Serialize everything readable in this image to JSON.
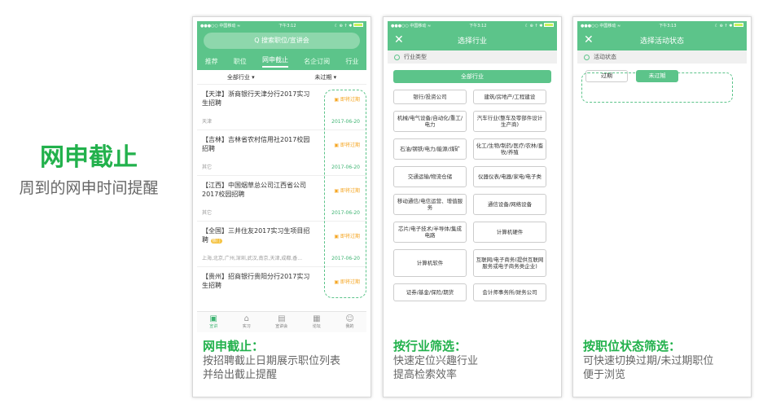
{
  "hero": {
    "title": "网申截止",
    "subtitle": "周到的网申时间提醒"
  },
  "status": {
    "carrier": "●●●○○ 中国移动 ≈",
    "time1": "下午3:12",
    "time3": "下午3:13",
    "icons": "☾ ⊕ ↑ ✱"
  },
  "screen1": {
    "search_placeholder": "Q 搜索职位/宣讲会",
    "tabs": [
      "推荐",
      "职位",
      "网申截止",
      "名企订阅",
      "行业"
    ],
    "filter_industry": "全部行业 ▾",
    "filter_status": "未过期 ▾",
    "jobs": [
      {
        "title": "【天津】浙商银行天津分行2017实习生招聘",
        "loc": "天津",
        "deadline": "▣ 即将过期",
        "date": "2017-06-20"
      },
      {
        "title": "【吉林】吉林省农村信用社2017校园招聘",
        "loc": "其它",
        "deadline": "▣ 即将过期",
        "date": "2017-06-20"
      },
      {
        "title": "【江西】中国烟草总公司江西省公司2017校园招聘",
        "loc": "其它",
        "deadline": "▣ 即将过期",
        "date": "2017-06-20"
      },
      {
        "title": "【全国】三井住友2017实习生项目招聘",
        "hot": "热门",
        "loc": "上海,北京,广州,深圳,武汉,南京,天津,成都,香...",
        "deadline": "▣ 即将过期",
        "date": "2017-06-20"
      },
      {
        "title": "【贵州】招商银行贵阳分行2017实习生招聘",
        "loc": "",
        "deadline": "▣ 即将过期",
        "date": ""
      }
    ],
    "nav": [
      "宣讲",
      "实习",
      "宣讲会",
      "论坛",
      "我的"
    ]
  },
  "screen2": {
    "title": "选择行业",
    "section": "行业类型",
    "all": "全部行业",
    "items": [
      "银行/投资公司",
      "建筑/房地产/工程建设",
      "机械/电气设备/自动化/重工/电力",
      "汽车行业(整车及零部件设计生产商)",
      "石油/钢铁/电力/能源/煤矿",
      "化工/生物/制药/医疗/农林/畜牧/养殖",
      "交通运输/物流仓储",
      "仪器仪表/电器/家电/电子类",
      "移动通信/电信运营、增值服务",
      "通信设备/网络设备",
      "芯片/电子技术/半导体/集成电路",
      "计算机硬件",
      "计算机软件",
      "互联网/电子商务(提供互联网服务或电子商务类企业)",
      "证券/基金/保险/期货",
      "会计师事务所/财务公司"
    ]
  },
  "screen3": {
    "title": "选择活动状态",
    "section": "活动状态",
    "expired": "过期",
    "not_expired": "未过期"
  },
  "captions": [
    {
      "title": "网申截止：",
      "lines": [
        "按招聘截止日期展示职位列表",
        "并给出截止提醒"
      ]
    },
    {
      "title": "按行业筛选：",
      "lines": [
        "快速定位兴趣行业",
        "提高检索效率"
      ]
    },
    {
      "title": "按职位状态筛选：",
      "lines": [
        "可快速切换过期/未过期职位",
        "便于浏览"
      ]
    }
  ],
  "colors": {
    "brand_green": "#5cc48a",
    "title_green": "#22b14c",
    "warn_orange": "#f5a623"
  }
}
